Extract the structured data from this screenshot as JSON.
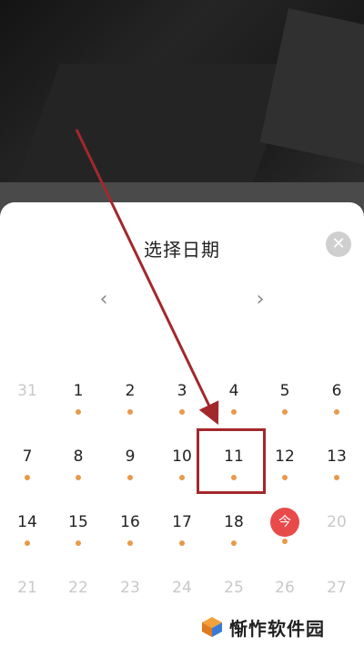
{
  "sheet": {
    "title": "选择日期",
    "close_icon": "close-icon",
    "prev_icon": "chevron-left-icon",
    "next_icon": "chevron-right-icon"
  },
  "calendar": {
    "rows": [
      [
        {
          "day": "31",
          "muted": true,
          "dot": false
        },
        {
          "day": "1",
          "dot": true
        },
        {
          "day": "2",
          "dot": true
        },
        {
          "day": "3",
          "dot": true
        },
        {
          "day": "4",
          "dot": true
        },
        {
          "day": "5",
          "dot": true
        },
        {
          "day": "6",
          "dot": true
        }
      ],
      [
        {
          "day": "7",
          "dot": true
        },
        {
          "day": "8",
          "dot": true
        },
        {
          "day": "9",
          "dot": true
        },
        {
          "day": "10",
          "dot": true
        },
        {
          "day": "11",
          "dot": true,
          "highlighted": true
        },
        {
          "day": "12",
          "dot": true
        },
        {
          "day": "13",
          "dot": true
        }
      ],
      [
        {
          "day": "14",
          "dot": true
        },
        {
          "day": "15",
          "dot": true
        },
        {
          "day": "16",
          "dot": true
        },
        {
          "day": "17",
          "dot": true
        },
        {
          "day": "18",
          "dot": true
        },
        {
          "day": "今",
          "dot": true,
          "today": true
        },
        {
          "day": "20",
          "muted": true,
          "dot": false
        }
      ],
      [
        {
          "day": "21",
          "muted": true,
          "dot": false
        },
        {
          "day": "22",
          "muted": true,
          "dot": false
        },
        {
          "day": "23",
          "muted": true,
          "dot": false
        },
        {
          "day": "24",
          "muted": true,
          "dot": false
        },
        {
          "day": "25",
          "muted": true,
          "dot": false
        },
        {
          "day": "26",
          "muted": true,
          "dot": false
        },
        {
          "day": "27",
          "muted": true,
          "dot": false
        }
      ]
    ]
  },
  "colors": {
    "dot": "#e89a4a",
    "today": "#e84a4a",
    "annotation": "#a3282c"
  },
  "watermark": {
    "text": "惭怍软件园"
  }
}
